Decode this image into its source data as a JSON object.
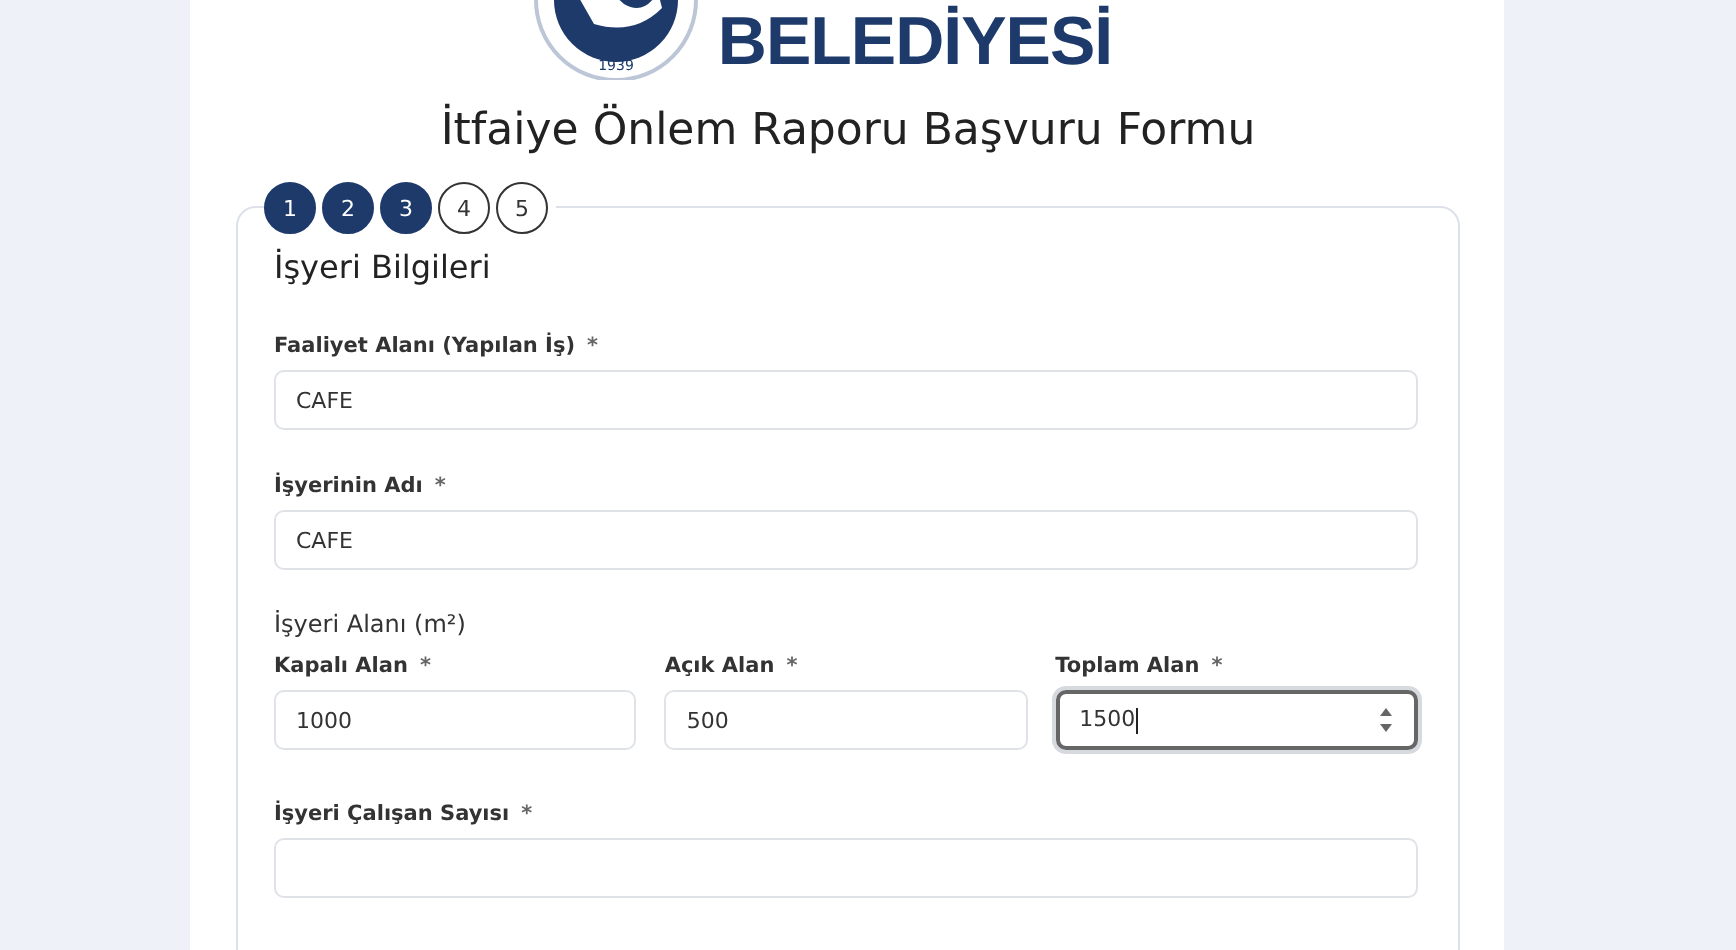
{
  "logo": {
    "year": "1939",
    "wordmark": "BELEDİYESİ"
  },
  "title": "İtfaiye Önlem Raporu Başvuru Formu",
  "steps": [
    {
      "label": "1",
      "done": true
    },
    {
      "label": "2",
      "done": true
    },
    {
      "label": "3",
      "done": true
    },
    {
      "label": "4",
      "done": false
    },
    {
      "label": "5",
      "done": false
    }
  ],
  "section": "İşyeri Bilgileri",
  "fields": [
    {
      "label": "Faaliyet Alanı (Yapılan İş)",
      "required": "*",
      "value": "CAFE",
      "focused": false
    },
    {
      "label": "İşyerinin Adı",
      "required": "*",
      "value": "CAFE",
      "focused": false
    }
  ],
  "area": {
    "heading": "İşyeri Alanı (m²)",
    "fields": [
      {
        "label": "Kapalı Alan",
        "required": "*",
        "value": "1000",
        "focused": false
      },
      {
        "label": "Açık Alan",
        "required": "*",
        "value": "500",
        "focused": false
      },
      {
        "label": "Toplam Alan",
        "required": "*",
        "value": "1500",
        "focused": true
      }
    ]
  },
  "employees": {
    "label": "İşyeri Çalışan Sayısı",
    "required": "*",
    "focused": false
  }
}
